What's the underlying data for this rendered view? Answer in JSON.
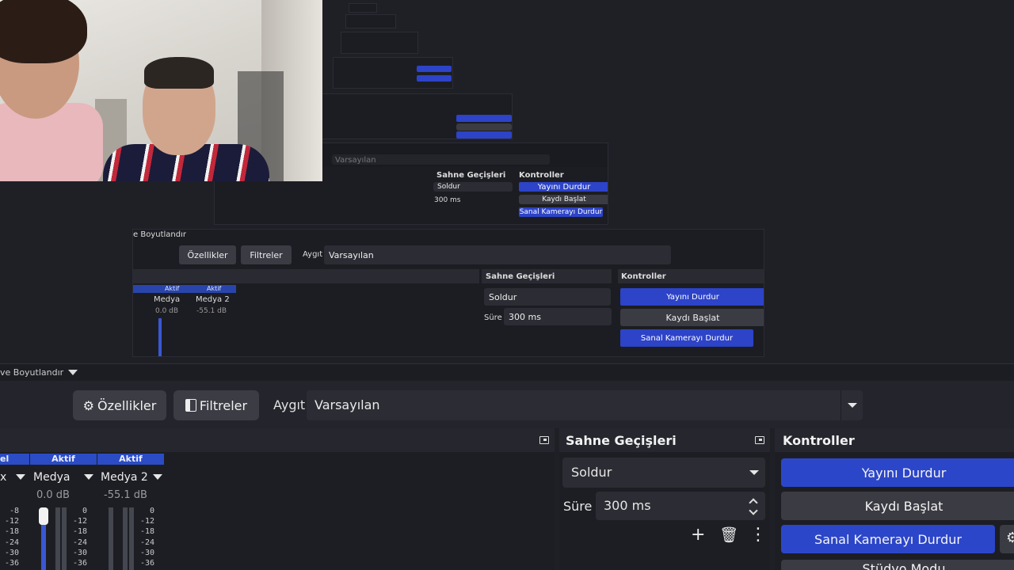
{
  "toolbar": {
    "label": "ve Boyutlandır"
  },
  "props_bar": {
    "properties_label": "Özellikler",
    "filters_label": "Filtreler",
    "device_label": "Aygıt",
    "device_value": "Varsayılan"
  },
  "mixer": {
    "channels": [
      {
        "header": "el",
        "name": "x",
        "db": ""
      },
      {
        "header": "Aktif",
        "name": "Medya",
        "db": "0.0 dB"
      },
      {
        "header": "Aktif",
        "name": "Medya 2",
        "db": "-55.1 dB"
      }
    ],
    "scale_a": "-8\n-12\n-18\n-24\n-30\n-36",
    "scale_b": "0\n-12\n-18\n-24\n-30\n-36"
  },
  "transitions": {
    "title": "Sahne Geçişleri",
    "selected": "Soldur",
    "duration_label": "Süre",
    "duration_value": "300 ms"
  },
  "controls": {
    "title": "Kontroller",
    "stop_stream": "Yayını Durdur",
    "start_record": "Kaydı Başlat",
    "stop_virtualcam": "Sanal Kamerayı Durdur",
    "studio_mode": "Stüdyo Modu"
  },
  "mirror": {
    "toolbar_label": "e Boyutlandır",
    "properties_label": "Özellikler",
    "filters_label": "Filtreler",
    "device_label": "Aygıt",
    "device_value": "Varsayılan",
    "trans_title": "Sahne Geçişleri",
    "ctrl_title": "Kontroller",
    "selected": "Soldur",
    "duration_label": "Süre",
    "duration_value": "300 ms",
    "stop_stream": "Yayını Durdur",
    "start_record": "Kaydı Başlat",
    "stop_virtualcam": "Sanal Kamerayı Durdur",
    "ch_active": "Aktif",
    "ch_media": "Medya",
    "ch_media2": "Medya 2",
    "db1": "0.0 dB",
    "db2": "-55.1 dB"
  },
  "colors": {
    "accent_blue": "#2c46c9",
    "panel": "#1d1e23",
    "button": "#3a3b43"
  }
}
